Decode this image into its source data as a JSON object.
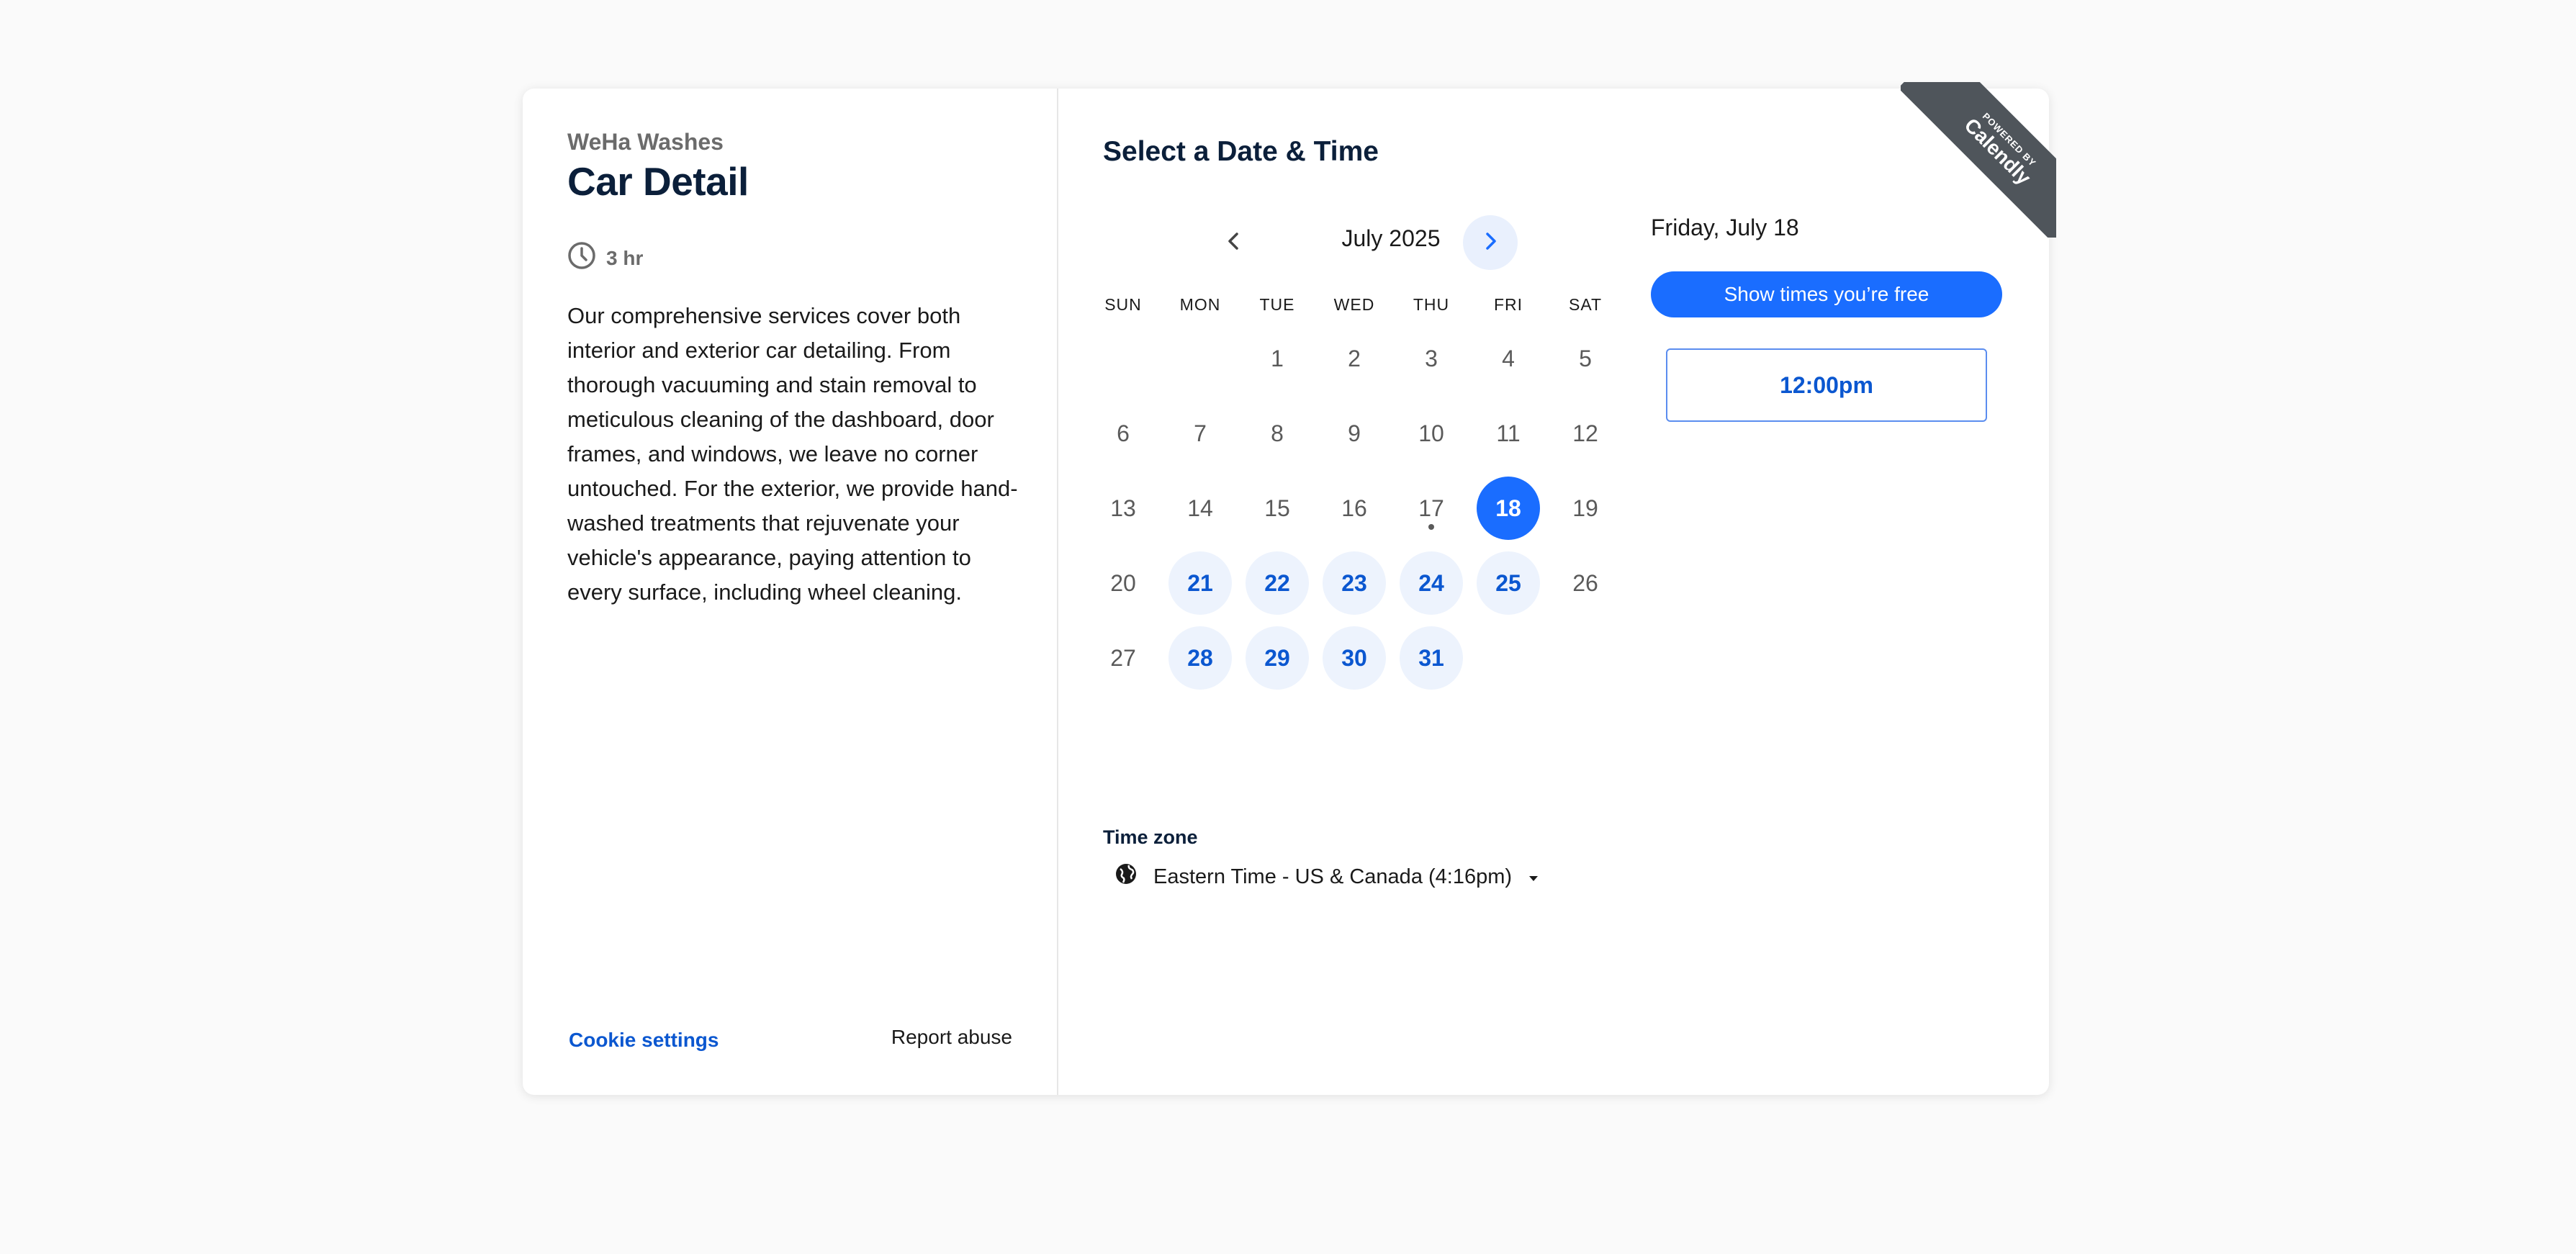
{
  "left": {
    "org_name": "WeHa Washes",
    "event_title": "Car Detail",
    "duration": "3 hr",
    "description": "Our comprehensive services cover both interior and exterior car detailing. From thorough vacuuming and stain removal to meticulous cleaning of the dashboard, door frames, and windows, we leave no corner untouched. For the exterior, we provide hand-washed treatments that rejuvenate your vehicle's appearance, paying attention to every surface, including wheel cleaning.",
    "cookie_settings": "Cookie settings",
    "report_abuse": "Report abuse"
  },
  "main": {
    "heading": "Select a Date & Time",
    "month_label": "July 2025",
    "weekdays": [
      "SUN",
      "MON",
      "TUE",
      "WED",
      "THU",
      "FRI",
      "SAT"
    ],
    "days": [
      {
        "d": "1",
        "state": "plain"
      },
      {
        "d": "2",
        "state": "plain"
      },
      {
        "d": "3",
        "state": "plain"
      },
      {
        "d": "4",
        "state": "plain"
      },
      {
        "d": "5",
        "state": "plain"
      },
      {
        "d": "6",
        "state": "plain"
      },
      {
        "d": "7",
        "state": "plain"
      },
      {
        "d": "8",
        "state": "plain"
      },
      {
        "d": "9",
        "state": "plain"
      },
      {
        "d": "10",
        "state": "plain"
      },
      {
        "d": "11",
        "state": "plain"
      },
      {
        "d": "12",
        "state": "plain"
      },
      {
        "d": "13",
        "state": "plain"
      },
      {
        "d": "14",
        "state": "plain"
      },
      {
        "d": "15",
        "state": "plain"
      },
      {
        "d": "16",
        "state": "plain"
      },
      {
        "d": "17",
        "state": "today"
      },
      {
        "d": "18",
        "state": "selected"
      },
      {
        "d": "19",
        "state": "plain"
      },
      {
        "d": "20",
        "state": "plain"
      },
      {
        "d": "21",
        "state": "available"
      },
      {
        "d": "22",
        "state": "available"
      },
      {
        "d": "23",
        "state": "available"
      },
      {
        "d": "24",
        "state": "available"
      },
      {
        "d": "25",
        "state": "available"
      },
      {
        "d": "26",
        "state": "plain"
      },
      {
        "d": "27",
        "state": "plain"
      },
      {
        "d": "28",
        "state": "available"
      },
      {
        "d": "29",
        "state": "available"
      },
      {
        "d": "30",
        "state": "available"
      },
      {
        "d": "31",
        "state": "available"
      }
    ],
    "first_weekday_index": 2,
    "timezone_label": "Time zone",
    "timezone_value": "Eastern Time - US & Canada (4:16pm)"
  },
  "times": {
    "selected_date": "Friday, July 18",
    "show_free_label": "Show times you’re free",
    "slots": [
      "12:00pm"
    ]
  },
  "ribbon": {
    "powered_by": "POWERED BY",
    "brand": "Calendly"
  },
  "colors": {
    "accent": "#1a6dff",
    "available_bg": "#edf3fd",
    "link": "#0b57d0",
    "ribbon": "#4f555b"
  },
  "icons": {
    "duration": "clock-icon",
    "prev_month": "chevron-left-icon",
    "next_month": "chevron-right-icon",
    "timezone": "globe-icon",
    "timezone_dropdown": "caret-down-icon"
  }
}
